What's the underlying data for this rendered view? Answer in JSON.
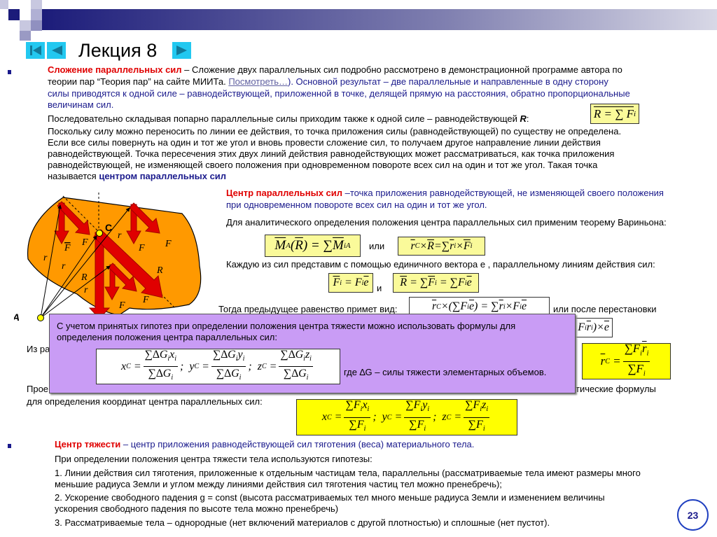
{
  "header": {
    "title": "Лекция 8",
    "colors": {
      "bar_start": "#1c1c7a",
      "bar_end": "#c8c8dc",
      "nav": "#22c8f0"
    }
  },
  "nav": {
    "first": "first-slide",
    "prev": "previous-slide",
    "next": "next-slide"
  },
  "section1": {
    "term": "Сложение параллельных сил",
    "lines": [
      " – Сложение двух параллельных сил подробно рассмотрено в демонстрационной программе автора по",
      "теории пар “Теория пар” на сайте МИИТа. ",
      "). Основной результат – две параллельные и направленные в одну сторону",
      "силы приводятся к одной силе – равнодействующей, приложенной в точке, делящей прямую на расстояния, обратно пропорциональные",
      "величинам сил."
    ],
    "link": "Посмотреть…",
    "p2": "Последовательно складывая попарно параллельные силы приходим также к одной силе – равнодействующей ",
    "p2_R": "R",
    "p2_end": ":",
    "formula_R": "R = ∑ F",
    "p3": [
      "Поскольку силу можно переносить по линии ее действия, то точка приложения силы (равнодействующей) по существу не определена.",
      "Если все силы повернуть на один и тот же угол и вновь провести сложение сил, то получаем другое направление линии действия",
      "равнодействующей. Точка пересечения этих двух линий действия равнодействующих может рассматриваться, как точка приложения",
      "равнодействующей, не изменяющей своего положения при одновременном повороте всех сил на один и тот же угол. Такая точка",
      "называется "
    ],
    "p3_term": "центром параллельных сил"
  },
  "center": {
    "term": "Центр параллельных сил",
    "def": [
      " –точка приложения равнодействующей, не изменяющей своего положения",
      "при одновременном повороте всех сил на один и тот же угол."
    ],
    "varignon": "Для аналитического определения положения центра параллельных сил применим теорему Вариньона:",
    "or": "или",
    "unit": "Каждую из сил представим с помощью единичного вектора e , параллельному линиям действия сил:",
    "and": "и",
    "then": "Тогда предыдущее равенство примет вид:",
    "after": "или после перестановки",
    "hidden_left1": "Из ра",
    "hidden_left2": "Прое",
    "hidden_right2": "тические формулы",
    "coords": "для определения координат центра параллельных сил:"
  },
  "popup": {
    "lines": [
      "С учетом принятых гипотез при определении положения центра тяжести можно использовать формулы для",
      "определения положения центра параллельных сил:"
    ],
    "where": "где ∆G – силы тяжести элементарных объемов.",
    "color": "#c99cf5"
  },
  "section2": {
    "term": "Центр тяжести",
    "def": " – центр приложения равнодействующей сил тяготения (веса) материального тела.",
    "lines": [
      "При определении положения центра тяжести тела используются гипотезы:",
      "1. Линии действия сил тяготения, приложенные к отдельным частицам тела, параллельны (рассматриваемые тела имеют размеры много",
      "меньшие радиуса Земли и углом между линиями действия сил тяготения частиц тел можно пренебречь);",
      "2. Ускорение свободного падения g = const (высота рассматриваемых тел много меньше радиуса Земли и изменением величины",
      "ускорения свободного падения по высоте тела можно пренебречь)",
      "3. Рассматриваемые тела – однородные (нет включений материалов с другой плотностью) и сплошные (нет пустот)."
    ]
  },
  "diagram": {
    "labels": {
      "C": "C",
      "A": "A",
      "F1": "F",
      "F2": "F",
      "F3": "F",
      "R": "R",
      "r1": "r",
      "r2": "r",
      "r3": "r",
      "rC": "r"
    },
    "body_color": "#ff9900",
    "arrow_color": "#e00000"
  },
  "page_number": "23"
}
